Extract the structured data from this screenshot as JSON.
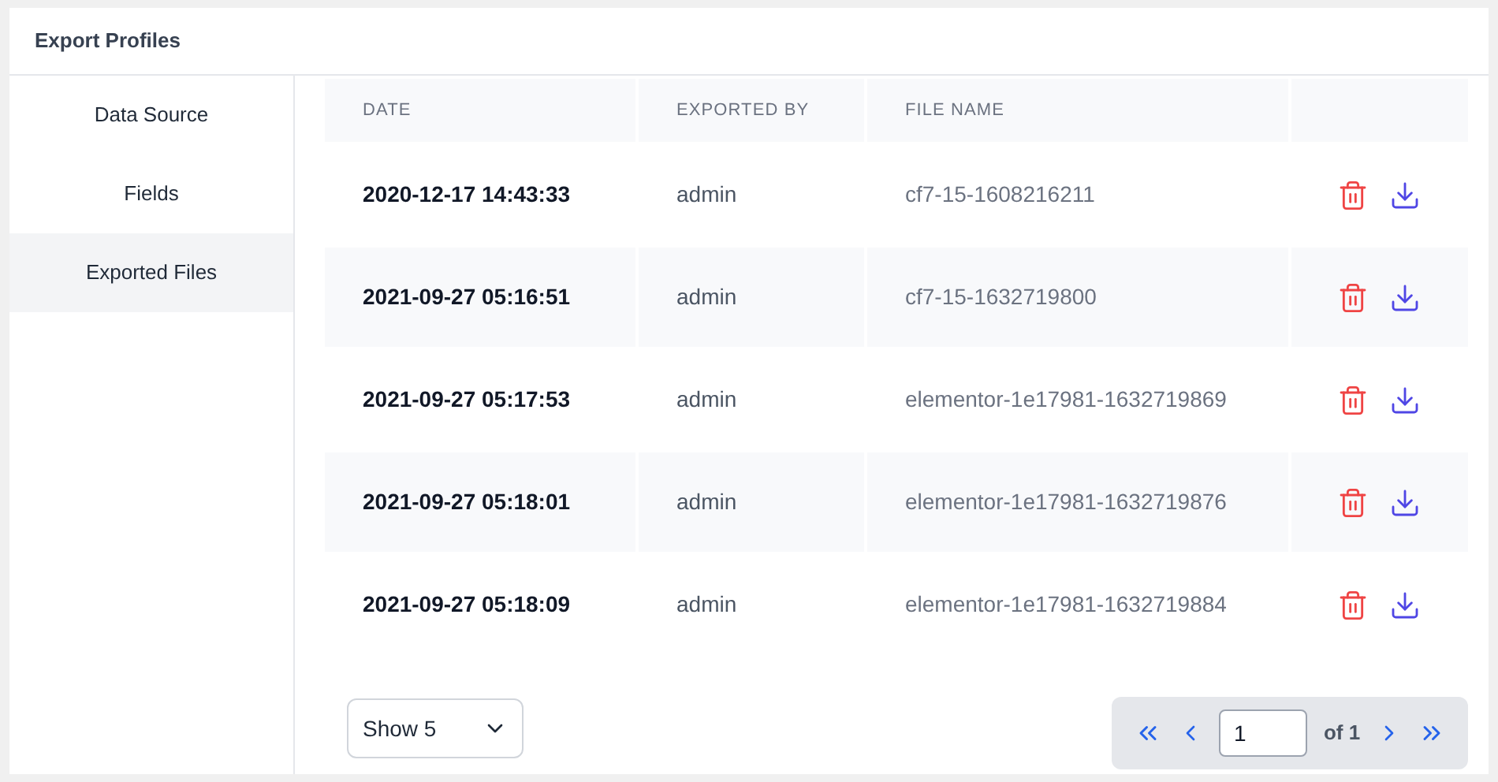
{
  "panel": {
    "title": "Export Profiles"
  },
  "sidebar": {
    "items": [
      {
        "label": "Data Source",
        "selected": false
      },
      {
        "label": "Fields",
        "selected": false
      },
      {
        "label": "Exported Files",
        "selected": true
      }
    ]
  },
  "table": {
    "columns": [
      "DATE",
      "EXPORTED BY",
      "FILE NAME"
    ],
    "rows": [
      {
        "date": "2020-12-17 14:43:33",
        "exported_by": "admin",
        "file_name": "cf7-15-1608216211"
      },
      {
        "date": "2021-09-27 05:16:51",
        "exported_by": "admin",
        "file_name": "cf7-15-1632719800"
      },
      {
        "date": "2021-09-27 05:17:53",
        "exported_by": "admin",
        "file_name": "elementor-1e17981-1632719869"
      },
      {
        "date": "2021-09-27 05:18:01",
        "exported_by": "admin",
        "file_name": "elementor-1e17981-1632719876"
      },
      {
        "date": "2021-09-27 05:18:09",
        "exported_by": "admin",
        "file_name": "elementor-1e17981-1632719884"
      }
    ]
  },
  "page_size": {
    "value": "Show 5"
  },
  "pagination": {
    "page": "1",
    "of": "of 1"
  }
}
